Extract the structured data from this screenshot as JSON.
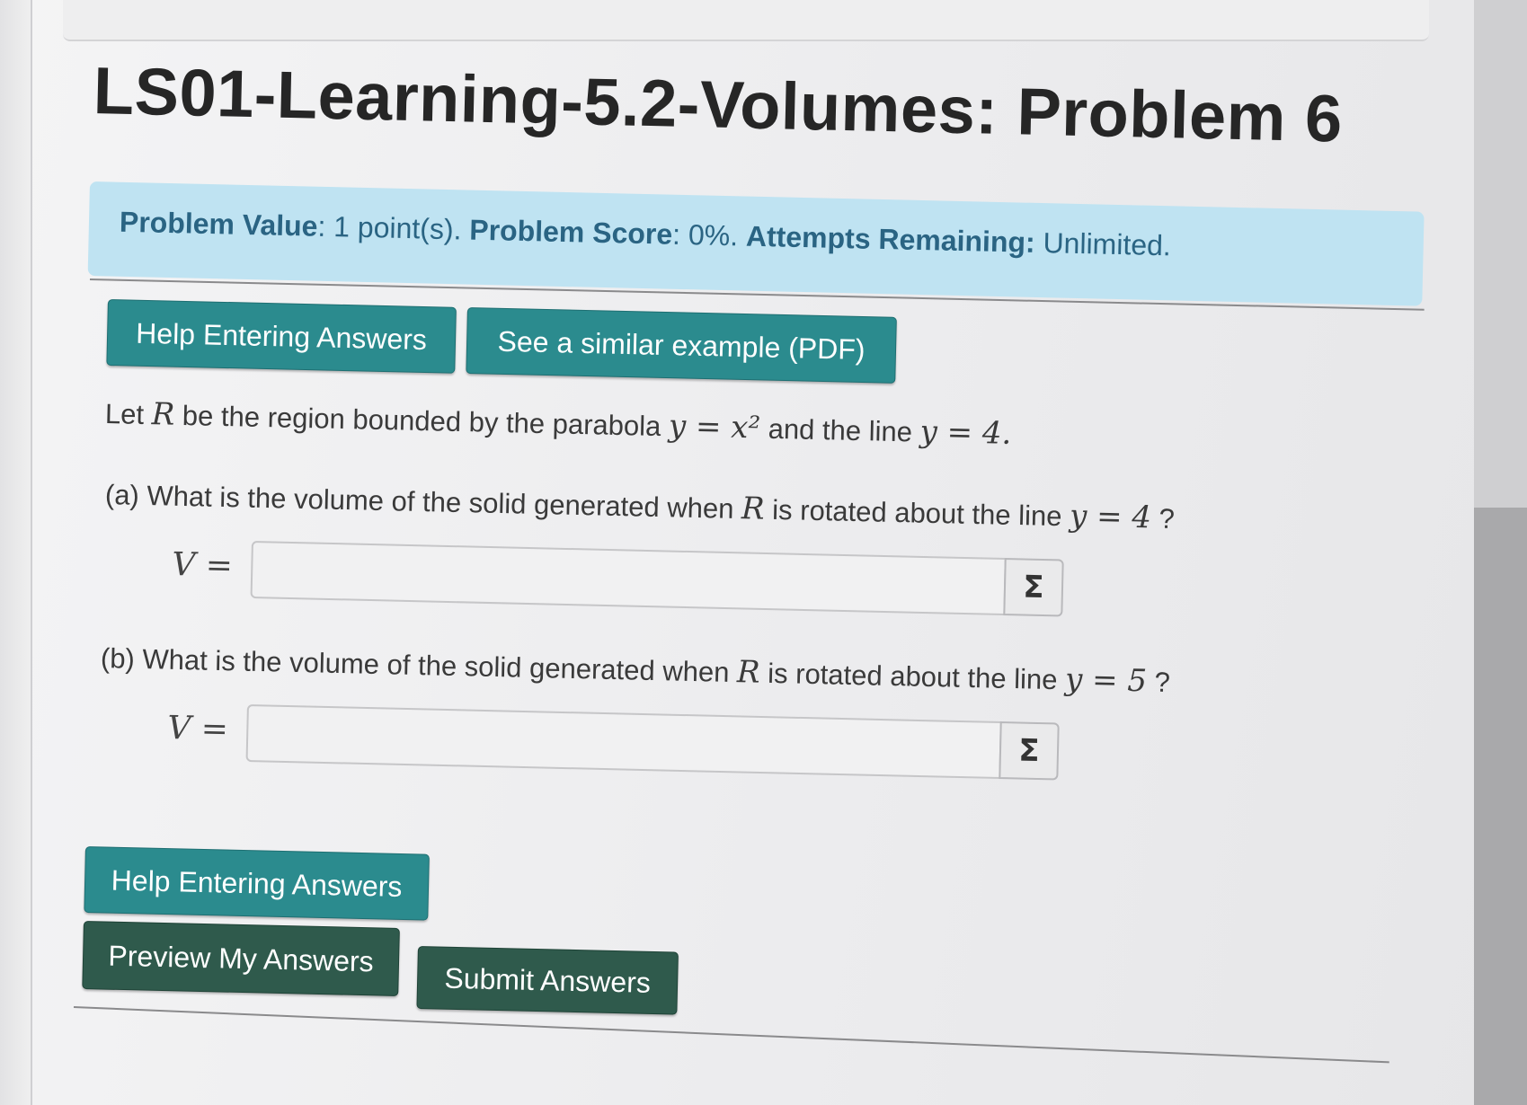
{
  "page": {
    "title": "LS01-Learning-5.2-Volumes: Problem 6"
  },
  "info": {
    "value_label": "Problem Value",
    "value_text": ": 1 point(s). ",
    "score_label": "Problem Score",
    "score_text": ": 0%. ",
    "attempts_label": "Attempts Remaining:",
    "attempts_text": " Unlimited."
  },
  "top_buttons": {
    "help": "Help Entering Answers",
    "similar": "See a similar example (PDF)"
  },
  "problem": {
    "intro_a": "Let ",
    "intro_R": "R",
    "intro_b": " be the region bounded by the parabola ",
    "intro_math1": "y = x²",
    "intro_c": " and the line ",
    "intro_math2": "y = 4.",
    "part_a_text": "(a) What is the volume of the solid generated when ",
    "part_a_R": "R",
    "part_a_rest": " is rotated about the line ",
    "part_a_math": "y = 4",
    "part_a_q": " ?",
    "part_b_text": "(b) What is the volume of the solid generated when ",
    "part_b_R": "R",
    "part_b_rest": " is rotated about the line ",
    "part_b_math": "y = 5",
    "part_b_q": " ?"
  },
  "answers": {
    "a_label": "V =",
    "a_value": "",
    "b_label": "V =",
    "b_value": "",
    "sigma": "Σ"
  },
  "bottom_buttons": {
    "help": "Help Entering Answers",
    "preview": "Preview My Answers",
    "submit": "Submit Answers"
  }
}
